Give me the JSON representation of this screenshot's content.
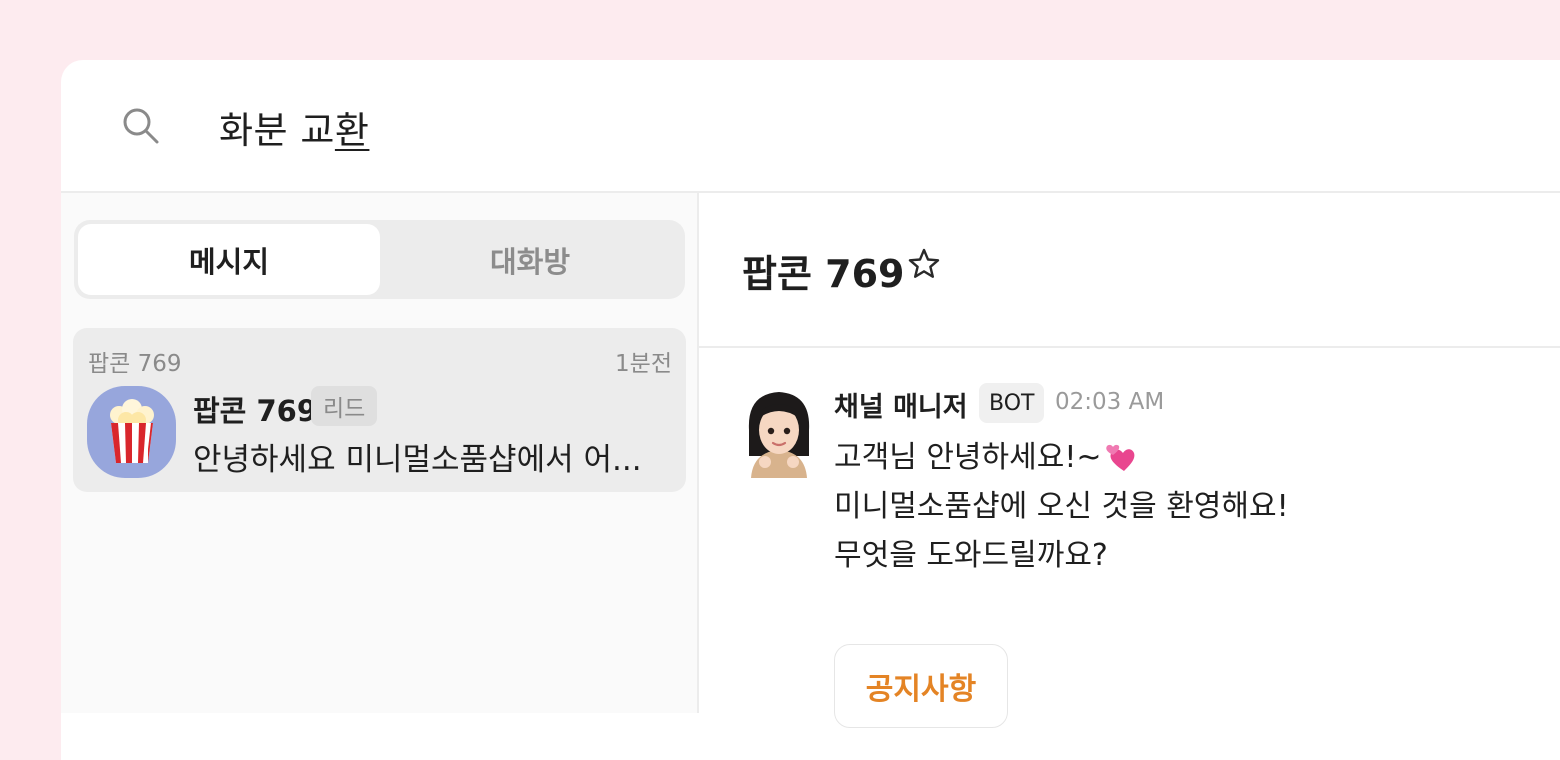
{
  "search": {
    "query_committed": "화분 교",
    "query_composing": "환",
    "icon": "search-icon"
  },
  "sidebar": {
    "tabs": [
      {
        "label": "메시지",
        "active": true
      },
      {
        "label": "대화방",
        "active": false
      }
    ],
    "conversations": [
      {
        "channel": "팝콘 769",
        "time": "1분전",
        "avatar_icon": "popcorn-icon",
        "avatar_color": "#97a6dc",
        "name": "팝콘 769",
        "badge": "리드",
        "preview": "안녕하세요 미니멀소품샵에서 어..."
      }
    ]
  },
  "room": {
    "title": "팝콘 769",
    "star_icon": "star-outline-icon",
    "messages": [
      {
        "sender": "채널 매니저",
        "badge": "BOT",
        "time": "02:03 AM",
        "avatar_icon": "memoji-avatar-icon",
        "lines": [
          "고객님 안녕하세요!~",
          "미니멀소품샵에 오신 것을 환영해요!",
          "무엇을 도와드릴까요?"
        ],
        "emoji_icon": "two-hearts-icon",
        "button_label": "공지사항",
        "button_color": "#e48425"
      }
    ]
  }
}
